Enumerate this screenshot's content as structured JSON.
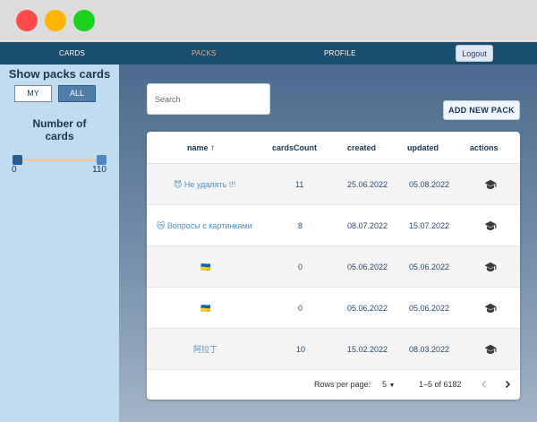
{
  "nav": {
    "cards": "CARDS",
    "packs": "PACKS",
    "profile": "PROFILE",
    "logout": "Logout"
  },
  "sidebar": {
    "title": "Show packs cards",
    "my": "MY",
    "all": "ALL",
    "number_title_1": "Number of",
    "number_title_2": "cards",
    "range": {
      "min": 0,
      "max": 110,
      "min_label": "0",
      "max_label": "110",
      "selected_min": 0,
      "selected_max": 110
    }
  },
  "main": {
    "search_placeholder": "Search",
    "add_button": "ADD NEW PACK"
  },
  "table": {
    "columns": {
      "name": "name",
      "sort_arrow": "↑",
      "cards_count": "cardsCount",
      "created": "created",
      "updated": "updated",
      "actions": "actions"
    },
    "rows": [
      {
        "name": "😈 Не удалять !!!",
        "count": "11",
        "created": "25.06.2022",
        "updated": "05.08.2022"
      },
      {
        "name": "😿 Вопросы с картинками",
        "count": "8",
        "created": "08.07.2022",
        "updated": "15.07.2022"
      },
      {
        "name": "🇺🇦",
        "count": "0",
        "created": "05.06.2022",
        "updated": "05.06.2022"
      },
      {
        "name": "🇺🇦",
        "count": "0",
        "created": "05.06.2022",
        "updated": "05.06.2022"
      },
      {
        "name": "阿拉丁",
        "count": "10",
        "created": "15.02.2022",
        "updated": "08.03.2022"
      }
    ],
    "footer": {
      "rows_per_page_label": "Rows per page:",
      "rows_per_page_value": "5",
      "range_text": "1–5 of 6182"
    }
  },
  "icons": {
    "action": "graduation-cap-icon",
    "prev": "chevron-left-icon",
    "next": "chevron-right-icon",
    "select": "caret-down-icon"
  },
  "colors": {
    "navbar": "#1a4d6e",
    "active_nav": "#e8b07a",
    "sidebar": "#bfdcf0",
    "link": "#4a8fc6"
  }
}
